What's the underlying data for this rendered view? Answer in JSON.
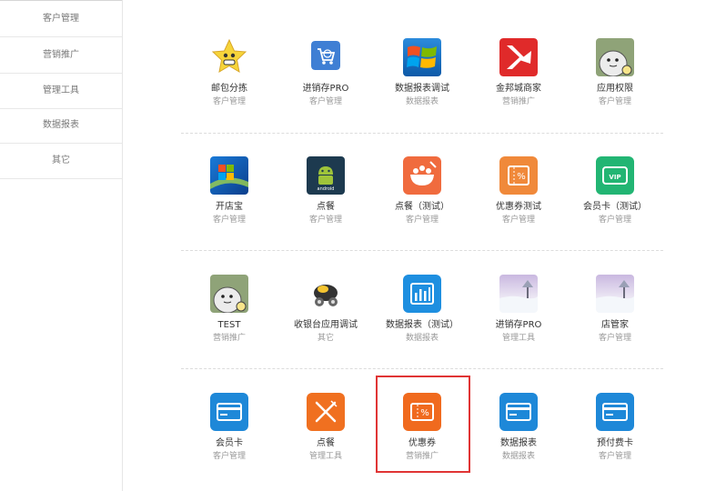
{
  "sidebar": {
    "items": [
      {
        "label": "客户管理"
      },
      {
        "label": "营销推广"
      },
      {
        "label": "管理工具"
      },
      {
        "label": "数据报表"
      },
      {
        "label": "其它"
      }
    ]
  },
  "apps": [
    {
      "name": "邮包分拣",
      "category": "客户管理",
      "icon": "star-face-icon"
    },
    {
      "name": "进销存PRO",
      "category": "客户管理",
      "icon": "shopping-cart-icon"
    },
    {
      "name": "数据报表调试",
      "category": "数据报表",
      "icon": "windows-logo-icon"
    },
    {
      "name": "金邦城商家",
      "category": "营销推广",
      "icon": "red-plane-logo-icon"
    },
    {
      "name": "应用权限",
      "category": "客户管理",
      "icon": "bird-egg-icon"
    },
    {
      "name": "开店宝",
      "category": "客户管理",
      "icon": "windows-desktop-icon"
    },
    {
      "name": "点餐",
      "category": "客户管理",
      "icon": "android-icon"
    },
    {
      "name": "点餐（测试）",
      "category": "客户管理",
      "icon": "food-bowl-icon"
    },
    {
      "name": "优惠券测试",
      "category": "客户管理",
      "icon": "coupon-ticket-icon"
    },
    {
      "name": "会员卡（测试）",
      "category": "客户管理",
      "icon": "vip-card-icon"
    },
    {
      "name": "TEST",
      "category": "营销推广",
      "icon": "bird-egg-icon"
    },
    {
      "name": "收银台应用调试",
      "category": "其它",
      "icon": "robot-toy-icon"
    },
    {
      "name": "数据报表（测试）",
      "category": "数据报表",
      "icon": "bar-chart-icon"
    },
    {
      "name": "进销存PRO",
      "category": "管理工具",
      "icon": "snow-landscape-icon"
    },
    {
      "name": "店管家",
      "category": "客户管理",
      "icon": "snow-landscape-icon"
    },
    {
      "name": "会员卡",
      "category": "客户管理",
      "icon": "card-icon"
    },
    {
      "name": "点餐",
      "category": "管理工具",
      "icon": "fork-knife-icon"
    },
    {
      "name": "优惠券",
      "category": "营销推广",
      "icon": "coupon-percent-icon"
    },
    {
      "name": "数据报表",
      "category": "数据报表",
      "icon": "card-icon"
    },
    {
      "name": "预付费卡",
      "category": "客户管理",
      "icon": "card-icon"
    }
  ],
  "colors": {
    "highlight": "#e03434",
    "blue": "#1e88d8",
    "orange": "#f07020"
  }
}
